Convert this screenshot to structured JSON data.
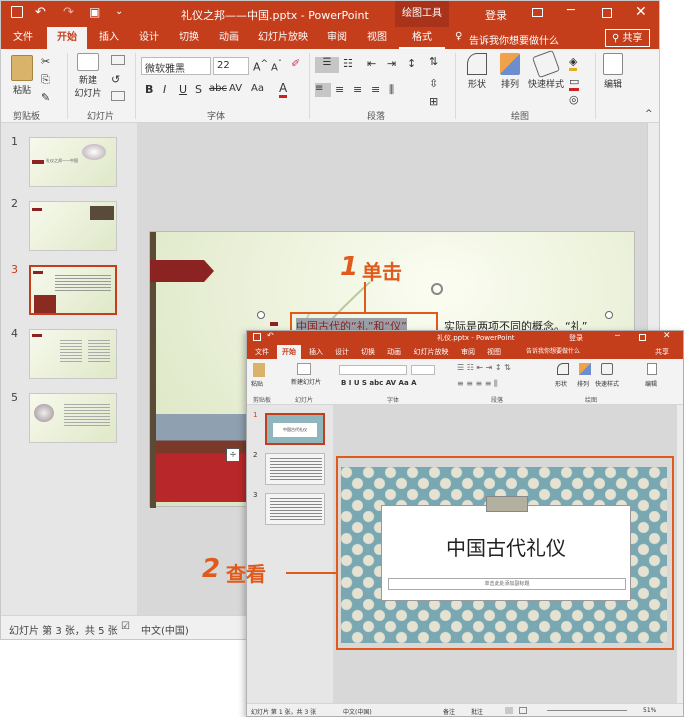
{
  "window": {
    "title": "礼仪之邦——中国.pptx - PowerPoint",
    "context_tab": "绘图工具",
    "login": "登录"
  },
  "tabs": [
    "文件",
    "开始",
    "插入",
    "设计",
    "切换",
    "动画",
    "幻灯片放映",
    "审阅",
    "视图",
    "格式"
  ],
  "tell_me": "告诉我你想要做什么",
  "share": "共享",
  "ribbon": {
    "paste": "粘贴",
    "new_slide_1": "新建",
    "new_slide_2": "幻灯片",
    "font_name": "微软雅黑",
    "font_size": "22",
    "shape": "形状",
    "arrange": "排列",
    "quick_styles": "快速样式",
    "edit": "编辑",
    "groups": [
      "剪贴板",
      "幻灯片",
      "字体",
      "段落",
      "绘图"
    ]
  },
  "thumbnails": {
    "numbers": [
      "1",
      "2",
      "3",
      "4",
      "5"
    ],
    "slide1_title": "礼仪之邦——中国"
  },
  "slide": {
    "highlight_text": "中国古代的“礼”和“仪”",
    "rest_text": "实际是两项不同的概念。“礼”"
  },
  "status": {
    "slide_info": "幻灯片 第 3 张，共 5 张",
    "language": "中文(中国)"
  },
  "callouts": {
    "one_num": "1",
    "one_text": "单击",
    "two_num": "2",
    "two_text": "查看"
  },
  "window2": {
    "title": "礼仪.pptx - PowerPoint",
    "login": "登录",
    "tabs": [
      "文件",
      "开始",
      "插入",
      "设计",
      "切换",
      "动画",
      "幻灯片放映",
      "审阅",
      "视图"
    ],
    "tell_me": "告诉我你想要做什么",
    "share": "共享",
    "groups": [
      "剪贴板",
      "幻灯片",
      "字体",
      "段落",
      "绘图"
    ],
    "ribbon_buttons": [
      "粘贴",
      "新建幻灯片",
      "形状",
      "排列",
      "快速样式",
      "编辑"
    ],
    "thumb_numbers": [
      "1",
      "2",
      "3"
    ],
    "thumb1_title": "中国古代礼仪",
    "slide_title": "中国古代礼仪",
    "slide_subtitle": "单击此处添加副标题",
    "status_left": "幻灯片 第 1 张，共 3 张",
    "status_lang": "中文(中国)",
    "notes": "备注",
    "comments": "批注",
    "zoom": "51%"
  }
}
